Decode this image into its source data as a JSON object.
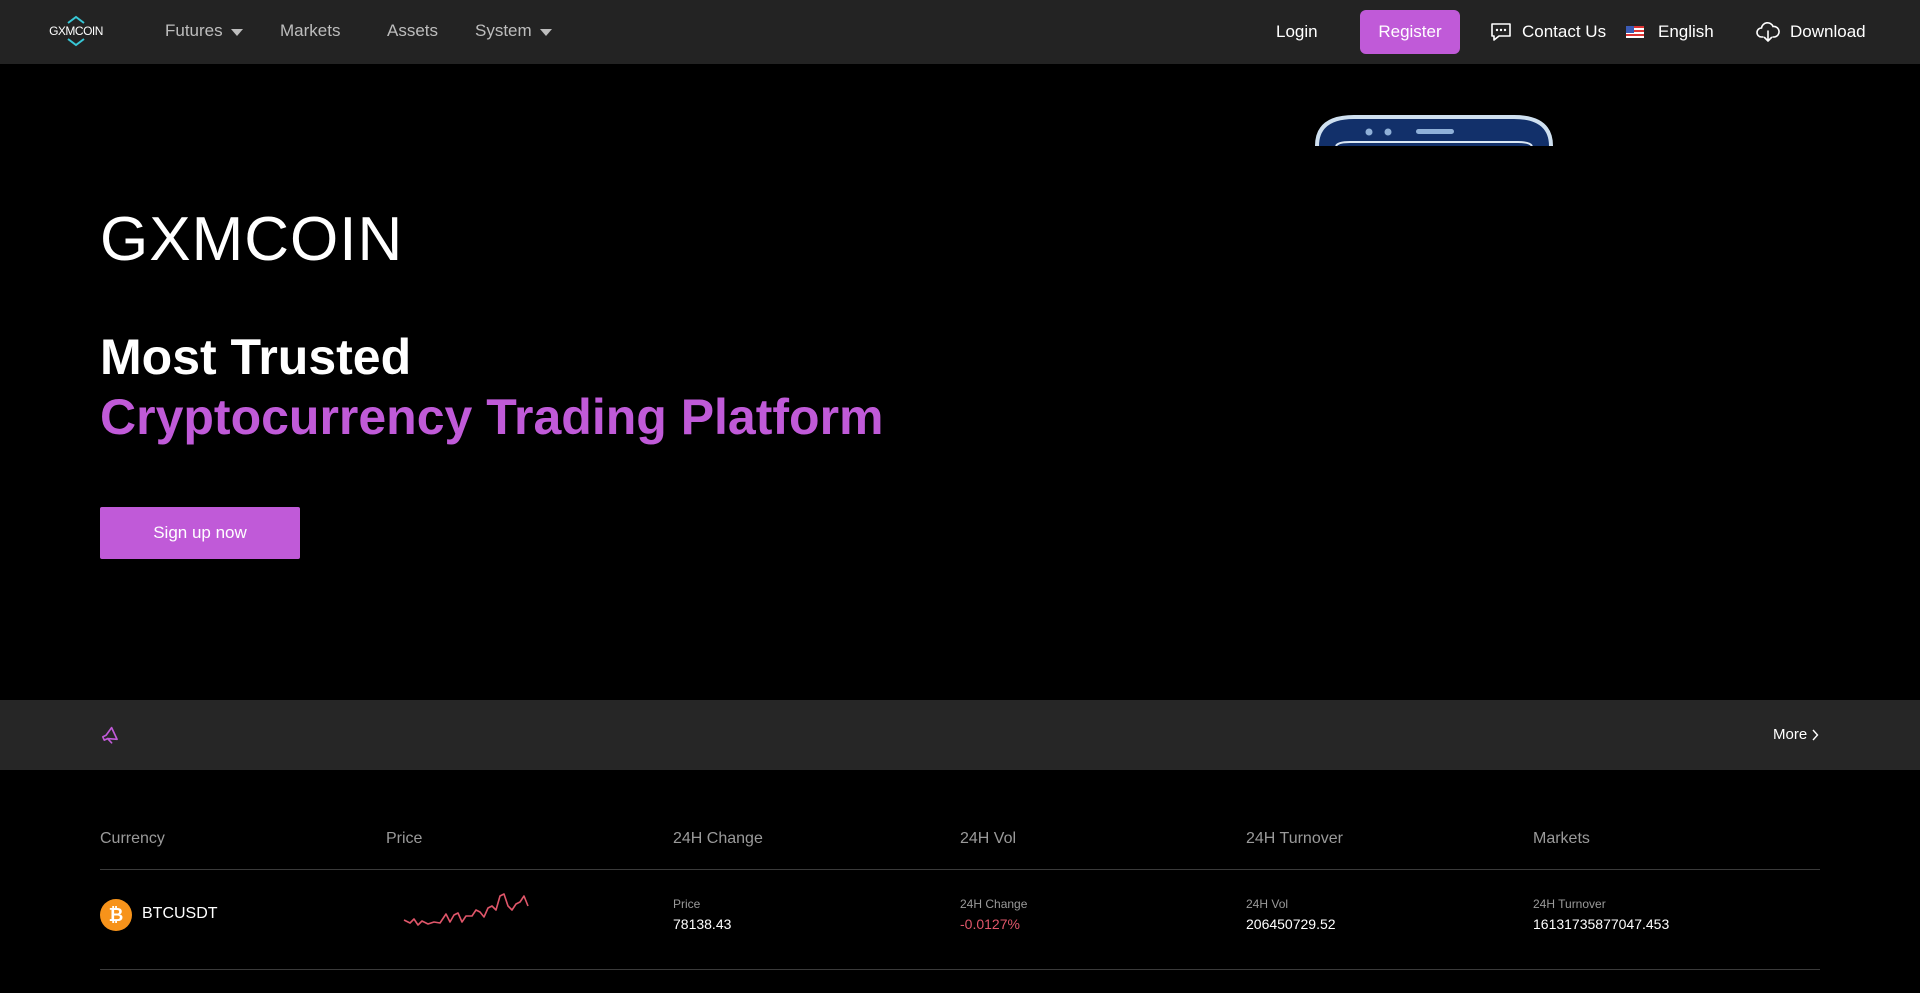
{
  "nav": {
    "logo_text": "GXMCOIN",
    "items": [
      {
        "label": "Futures",
        "has_dropdown": true
      },
      {
        "label": "Markets",
        "has_dropdown": false
      },
      {
        "label": "Assets",
        "has_dropdown": false
      },
      {
        "label": "System",
        "has_dropdown": true
      }
    ],
    "login": "Login",
    "register": "Register",
    "contact": "Contact Us",
    "language": "English",
    "download": "Download"
  },
  "hero": {
    "brand": "GXMCOIN",
    "line1": "Most Trusted",
    "line2": "Cryptocurrency Trading Platform",
    "cta": "Sign up now"
  },
  "notice": {
    "more": "More"
  },
  "market": {
    "headers": [
      "Currency",
      "Price",
      "24H Change",
      "24H Vol",
      "24H Turnover",
      "Markets"
    ],
    "rows": [
      {
        "symbol": "BTCUSDT",
        "icon": "bitcoin-icon",
        "price_label": "Price",
        "price": "78138.43",
        "change_label": "24H Change",
        "change": "-0.0127%",
        "vol_label": "24H Vol",
        "vol": "206450729.52",
        "turnover_label": "24H Turnover",
        "turnover": "16131735877047.453"
      }
    ]
  },
  "colors": {
    "accent": "#c05ad8",
    "negative": "#e0566a",
    "nav_bg": "#232323",
    "notice_bg": "#262626"
  }
}
